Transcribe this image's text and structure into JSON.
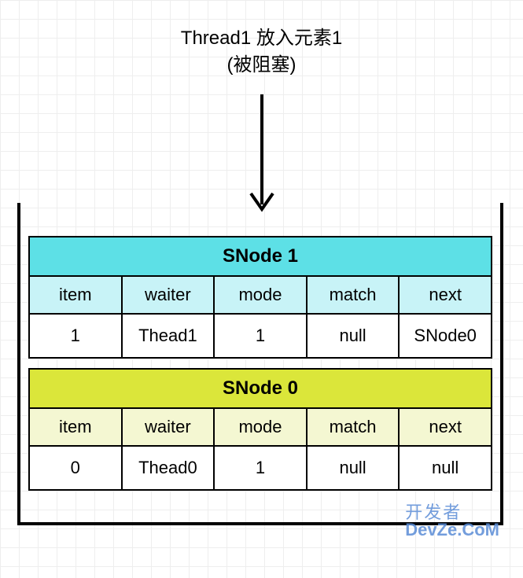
{
  "caption": {
    "line1": "Thread1 放入元素1",
    "line2": "(被阻塞)"
  },
  "nodes": {
    "snode1": {
      "title": "SNode 1",
      "headers": {
        "item": "item",
        "waiter": "waiter",
        "mode": "mode",
        "match": "match",
        "next": "next"
      },
      "values": {
        "item": "1",
        "waiter": "Thead1",
        "mode": "1",
        "match": "null",
        "next": "SNode0"
      }
    },
    "snode0": {
      "title": "SNode 0",
      "headers": {
        "item": "item",
        "waiter": "waiter",
        "mode": "mode",
        "match": "match",
        "next": "next"
      },
      "values": {
        "item": "0",
        "waiter": "Thead0",
        "mode": "1",
        "match": "null",
        "next": "null"
      }
    }
  },
  "watermark": {
    "line1": "开发者",
    "line2": "DevZe.CoM"
  }
}
